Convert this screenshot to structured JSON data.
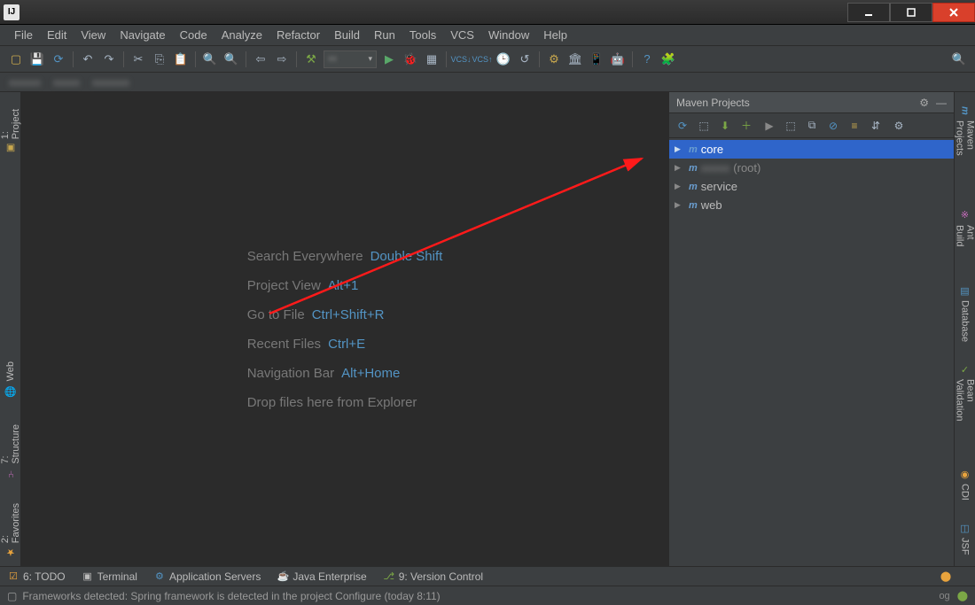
{
  "titlebar": {
    "ij": "IJ"
  },
  "menu": {
    "file": "File",
    "edit": "Edit",
    "view": "View",
    "navigate": "Navigate",
    "code": "Code",
    "analyze": "Analyze",
    "refactor": "Refactor",
    "build": "Build",
    "run": "Run",
    "tools": "Tools",
    "vcs": "VCS",
    "window": "Window",
    "help": "Help"
  },
  "left_tabs": {
    "project": "1: Project",
    "web": "Web",
    "structure": "7: Structure",
    "favorites": "2: Favorites"
  },
  "placeholder": {
    "search": "Search Everywhere",
    "search_key": "Double Shift",
    "project": "Project View",
    "project_key": "Alt+1",
    "gotofile": "Go to File",
    "gotofile_key": "Ctrl+Shift+R",
    "recent": "Recent Files",
    "recent_key": "Ctrl+E",
    "navbar": "Navigation Bar",
    "navbar_key": "Alt+Home",
    "drop": "Drop files here from Explorer"
  },
  "maven": {
    "title": "Maven Projects",
    "tree": {
      "core": "core",
      "root_suffix": "(root)",
      "root_name": "xxxxx",
      "service": "service",
      "web": "web"
    }
  },
  "right_tabs": {
    "maven": "Maven Projects",
    "ant": "Ant Build",
    "database": "Database",
    "bean": "Bean Validation",
    "cdi": "CDI",
    "jsf": "JSF"
  },
  "bottom_tabs": {
    "todo": "6: TODO",
    "terminal": "Terminal",
    "appservers": "Application Servers",
    "javaee": "Java Enterprise",
    "vcs": "9: Version Control"
  },
  "status": {
    "text": "Frameworks detected: Spring framework is detected in the project Configure (today 8:11)",
    "right": "og"
  }
}
